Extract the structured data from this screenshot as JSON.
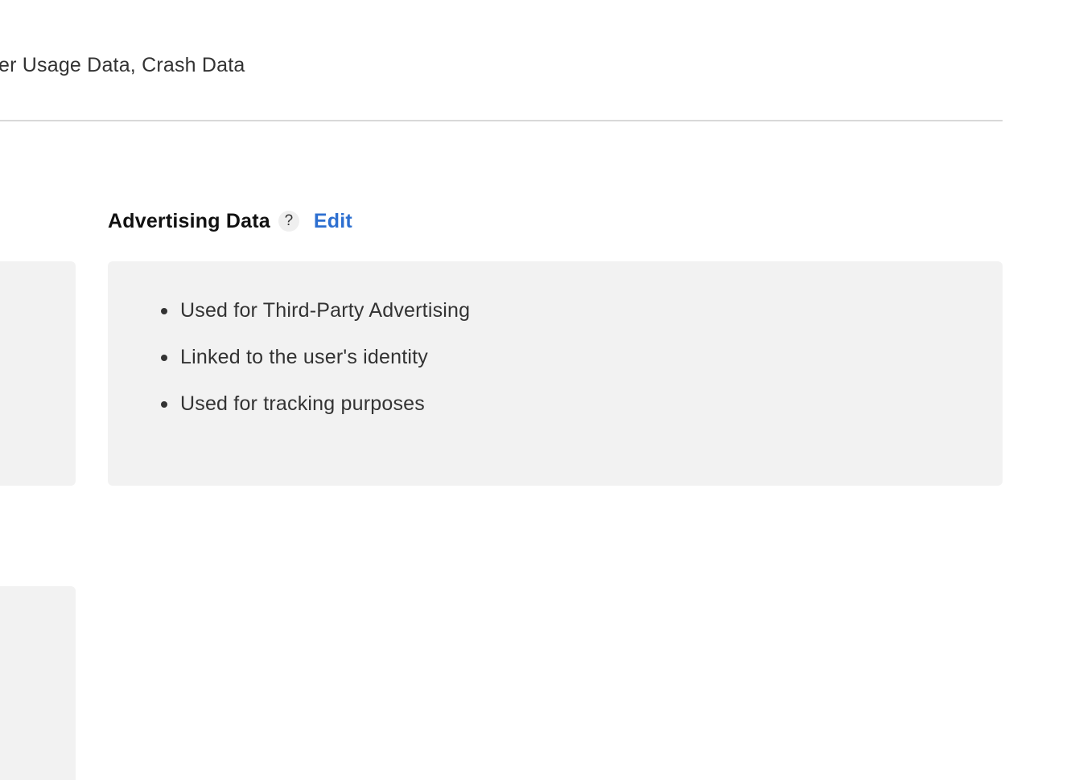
{
  "top_summary": {
    "text": "er Usage Data, Crash Data"
  },
  "advertising_section": {
    "title": "Advertising Data",
    "help_symbol": "?",
    "edit_label": "Edit",
    "items": [
      "Used for Third-Party Advertising",
      "Linked to the user's identity",
      "Used for tracking purposes"
    ]
  },
  "colors": {
    "link": "#2d6fd0",
    "card_background": "#f2f2f2",
    "divider": "#d8d8d8",
    "text": "#333333",
    "heading": "#111111"
  },
  "icons": {
    "help": "question-mark-circle-icon",
    "bullet": "bullet-dot-icon"
  }
}
